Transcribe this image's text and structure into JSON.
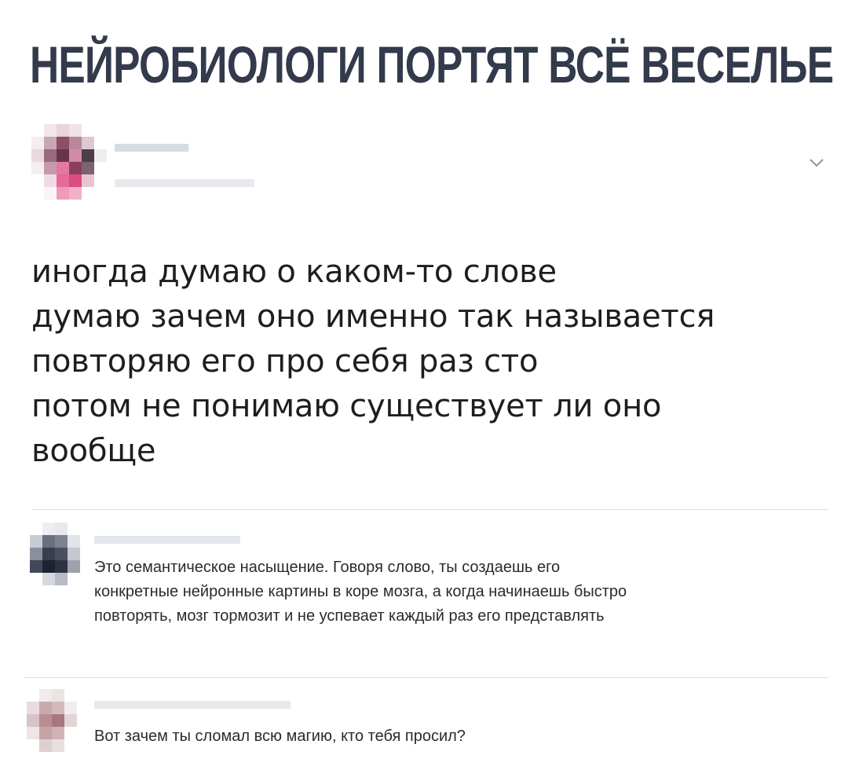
{
  "headline": "НЕЙРОБИОЛОГИ ПОРТЯТ ВСЁ ВЕСЕЛЬЕ",
  "post": {
    "lines": [
      "иногда думаю о каком-то слове",
      "думаю зачем оно именно так называется",
      "повторяю его про себя раз сто",
      "потом не понимаю существует ли оно",
      "вообще"
    ],
    "menu_icon": "chevron-down-icon"
  },
  "comments": [
    {
      "lines": [
        "Это семантическое насыщение. Говоря слово, ты создаешь его",
        "конкретные нейронные картины в коре мозга, а когда начинаешь быстро",
        "повторять, мозг тормозит и не успевает каждый раз его представлять"
      ]
    },
    {
      "lines": [
        "Вот зачем ты сломал всю магию, кто тебя просил?"
      ]
    }
  ],
  "colors": {
    "headline": "#323a4b",
    "divider": "#dcdcdc",
    "redacted": "#c9cfd8"
  }
}
